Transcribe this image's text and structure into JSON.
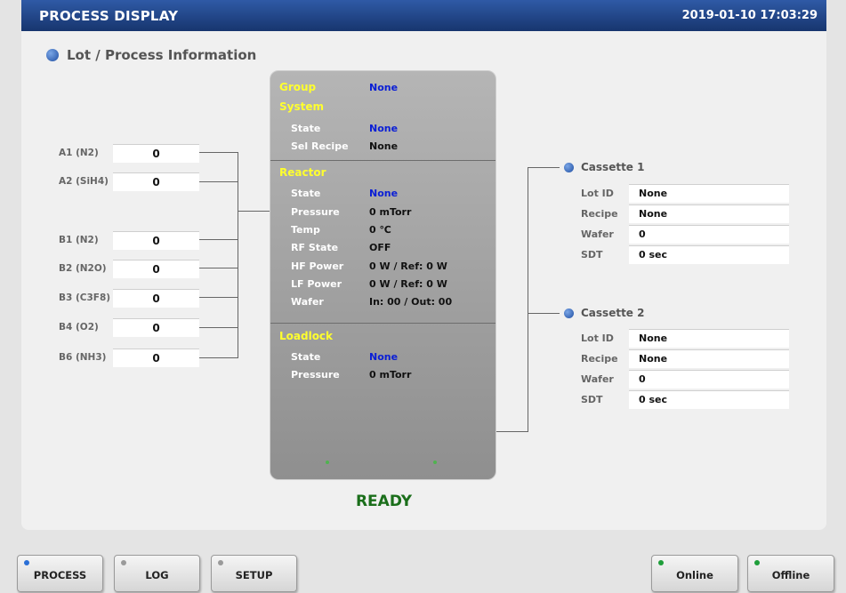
{
  "header": {
    "title": "PROCESS DISPLAY",
    "datetime": "2019-01-10 17:03:29"
  },
  "section": {
    "title": "Lot / Process Information"
  },
  "gases": [
    {
      "label": "A1 (N2)",
      "value": "0"
    },
    {
      "label": "A2 (SiH4)",
      "value": "0"
    },
    {
      "label": "B1 (N2)",
      "value": "0"
    },
    {
      "label": "B2 (N2O)",
      "value": "0"
    },
    {
      "label": "B3 (C3F8)",
      "value": "0"
    },
    {
      "label": "B4 (O2)",
      "value": "0"
    },
    {
      "label": "B6 (NH3)",
      "value": "0"
    }
  ],
  "center": {
    "group_label": "Group",
    "group_value": "None",
    "system": {
      "header": "System",
      "state_label": "State",
      "state_value": "None",
      "recipe_label": "Sel Recipe",
      "recipe_value": "None"
    },
    "reactor": {
      "header": "Reactor",
      "rows": [
        {
          "label": "State",
          "value": "None"
        },
        {
          "label": "Pressure",
          "value": "0 mTorr"
        },
        {
          "label": "Temp",
          "value": "0 ℃"
        },
        {
          "label": "RF State",
          "value": "OFF"
        },
        {
          "label": "HF Power",
          "value": "0 W / Ref: 0 W"
        },
        {
          "label": "LF Power",
          "value": "0 W / Ref: 0 W"
        },
        {
          "label": "Wafer",
          "value": "In: 00 / Out: 00"
        }
      ]
    },
    "loadlock": {
      "header": "Loadlock",
      "state_label": "State",
      "state_value": "None",
      "pressure_label": "Pressure",
      "pressure_value": "0 mTorr"
    }
  },
  "status": "READY",
  "cassettes": [
    {
      "title": "Cassette 1",
      "rows": [
        {
          "label": "Lot ID",
          "value": "None"
        },
        {
          "label": "Recipe",
          "value": "None"
        },
        {
          "label": "Wafer",
          "value": "0"
        },
        {
          "label": "SDT",
          "value": "0 sec"
        }
      ]
    },
    {
      "title": "Cassette 2",
      "rows": [
        {
          "label": "Lot ID",
          "value": "None"
        },
        {
          "label": "Recipe",
          "value": "None"
        },
        {
          "label": "Wafer",
          "value": "0"
        },
        {
          "label": "SDT",
          "value": "0 sec"
        }
      ]
    }
  ],
  "nav": {
    "process": {
      "label": "PROCESS",
      "led": "#2a6fd6"
    },
    "log": {
      "label": "LOG",
      "led": "#9a9a9a"
    },
    "setup": {
      "label": "SETUP",
      "led": "#9a9a9a"
    },
    "online": {
      "label": "Online",
      "led": "#1f9e3a"
    },
    "offline": {
      "label": "Offline",
      "led": "#1f9e3a"
    }
  },
  "colors": {
    "header_start": "#2f5aa6",
    "header_end": "#17356e",
    "status_green": "#1a6e1a",
    "value_blue": "#0a1ed6",
    "panel_yellow": "#ffff2e"
  }
}
